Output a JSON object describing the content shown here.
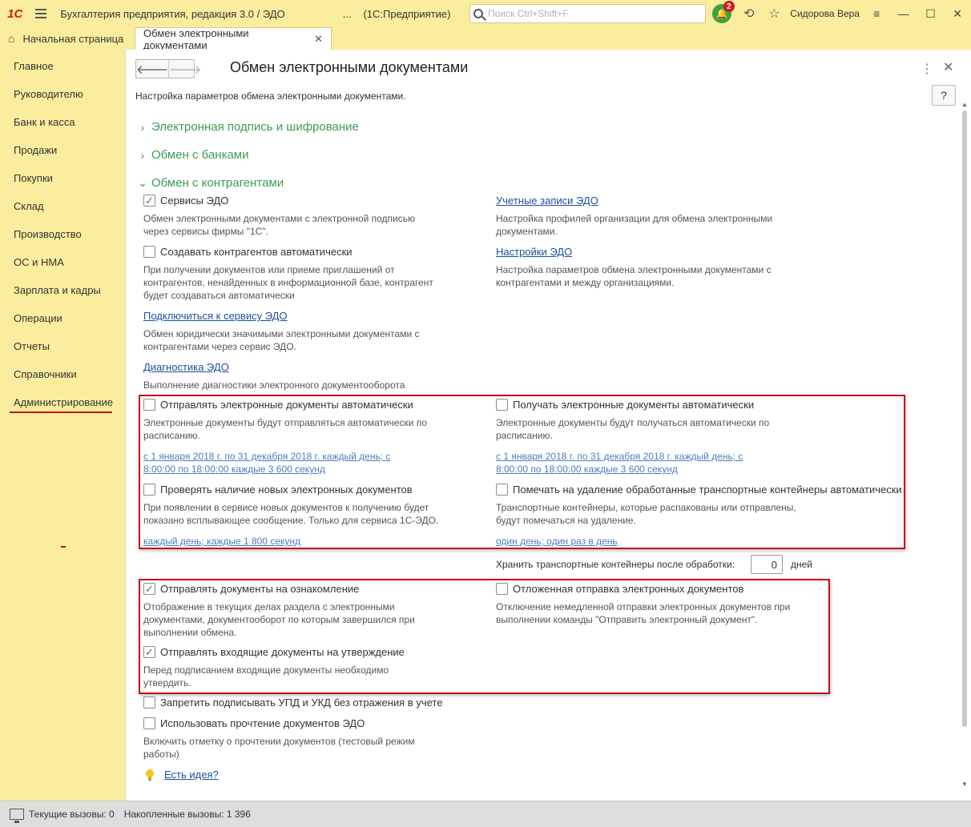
{
  "titlebar": {
    "logo": "1С",
    "app_title": "Бухгалтерия предприятия, редакция 3.0 / ЭДО",
    "ellipsis": "...",
    "mode": "(1С:Предприятие)",
    "search_placeholder": "Поиск Ctrl+Shift+F",
    "notifications_count": "2",
    "user": "Сидорова Вера"
  },
  "tabs": {
    "home": "Начальная страница",
    "active": "Обмен электронными документами"
  },
  "sidebar": {
    "items": [
      {
        "label": "Главное"
      },
      {
        "label": "Руководителю"
      },
      {
        "label": "Банк и касса"
      },
      {
        "label": "Продажи"
      },
      {
        "label": "Покупки"
      },
      {
        "label": "Склад"
      },
      {
        "label": "Производство"
      },
      {
        "label": "ОС и НМА"
      },
      {
        "label": "Зарплата и кадры"
      },
      {
        "label": "Операции"
      },
      {
        "label": "Отчеты"
      },
      {
        "label": "Справочники"
      },
      {
        "label": "Администрирование"
      }
    ],
    "active_index": 12
  },
  "form": {
    "title": "Обмен электронными документами",
    "help": "?",
    "subtitle": "Настройка параметров обмена электронными документами.",
    "sections": {
      "signature": "Электронная подпись и шифрование",
      "banks": "Обмен с банками",
      "counterparties": "Обмен с контрагентами"
    },
    "edo_services": {
      "label": "Сервисы ЭДО",
      "checked": true,
      "desc1": "Обмен электронными документами с электронной подписью",
      "desc2": "через сервисы фирмы \"1С\"."
    },
    "edo_accounts": {
      "link": "Учетные записи ЭДО",
      "desc1": "Настройка профилей организации для обмена электронными",
      "desc2": "документами."
    },
    "auto_counterparties": {
      "label": "Создавать контрагентов автоматически",
      "checked": false,
      "desc1": "При получении документов или приеме приглашений от",
      "desc2": "контрагентов, ненайденных в информационной базе, контрагент",
      "desc3": "будет создаваться автоматически"
    },
    "edo_settings": {
      "link": "Настройки ЭДО",
      "desc1": "Настройка параметров обмена электронными документами с",
      "desc2": "контрагентами и между организациями."
    },
    "connect_service": {
      "link": "Подключиться к сервису ЭДО",
      "desc1": "Обмен юридически значимыми электронными документами с",
      "desc2": "контрагентами через сервис ЭДО."
    },
    "diagnostics": {
      "link": "Диагностика ЭДО",
      "desc": "Выполнение диагностики электронного документооборота"
    },
    "send_auto": {
      "label": "Отправлять электронные документы автоматически",
      "checked": false,
      "desc1": "Электронные документы будут отправляться автоматически по",
      "desc2": "расписанию.",
      "schedule1": "с 1 января 2018 г. по 31 декабря 2018 г. каждый день; с",
      "schedule2": "8:00:00 по 18:00:00 каждые 3 600 секунд"
    },
    "receive_auto": {
      "label": "Получать электронные документы автоматически",
      "checked": false,
      "desc1": "Электронные документы будут получаться автоматически по",
      "desc2": "расписанию.",
      "schedule1": "с 1 января 2018 г. по 31 декабря 2018 г. каждый день; с",
      "schedule2": "8:00:00 по 18:00:00 каждые 3 600 секунд"
    },
    "check_new": {
      "label": "Проверять наличие новых электронных документов",
      "checked": false,
      "desc1": "При появлении в сервисе новых документов к получению будет",
      "desc2": "показано всплывающее сообщение. Только для сервиса 1С-ЭДО.",
      "schedule": "каждый день; каждые 1 800 секунд"
    },
    "mark_delete": {
      "label": "Помечать на удаление обработанные транспортные контейнеры автоматически",
      "checked": false,
      "desc1": "Транспортные контейнеры, которые распакованы или отправлены,",
      "desc2": "будут помечаться на удаление.",
      "schedule": "один день; один раз в день"
    },
    "keep_containers": {
      "label": "Хранить транспортные контейнеры после обработки:",
      "value": "0",
      "unit": "дней"
    },
    "send_for_review": {
      "label": "Отправлять документы на ознакомление",
      "checked": true,
      "desc1": "Отображение в текущих делах  раздела с электронными",
      "desc2": "документами, документооборот по которым завершился при",
      "desc3": "выполнении обмена."
    },
    "deferred_send": {
      "label": "Отложенная отправка электронных документов",
      "checked": false,
      "desc1": "Отключение немедленной отправки электронных документов при",
      "desc2": "выполнении команды \"Отправить электронный документ\"."
    },
    "send_incoming_approval": {
      "label": "Отправлять входящие документы на утверждение",
      "checked": true,
      "desc1": "Перед подписанием входящие документы необходимо",
      "desc2": "утвердить."
    },
    "forbid_sign_upd": {
      "label": "Запретить подписывать УПД и УКД без отражения в учете",
      "checked": false
    },
    "use_read_receipt": {
      "label": "Использовать прочтение документов ЭДО",
      "checked": false,
      "desc1": "Включить отметку о прочтении документов (тестовый режим",
      "desc2": "работы)"
    },
    "idea_link": "Есть идея?"
  },
  "statusbar": {
    "current_calls": "Текущие вызовы: 0",
    "accumulated_calls": "Накопленные вызовы: 1 396"
  },
  "colors": {
    "panel_bg": "#fbed9e",
    "section_green": "#3f9b58",
    "link_blue": "#1c4e9a",
    "highlight_red": "#c2121a"
  }
}
